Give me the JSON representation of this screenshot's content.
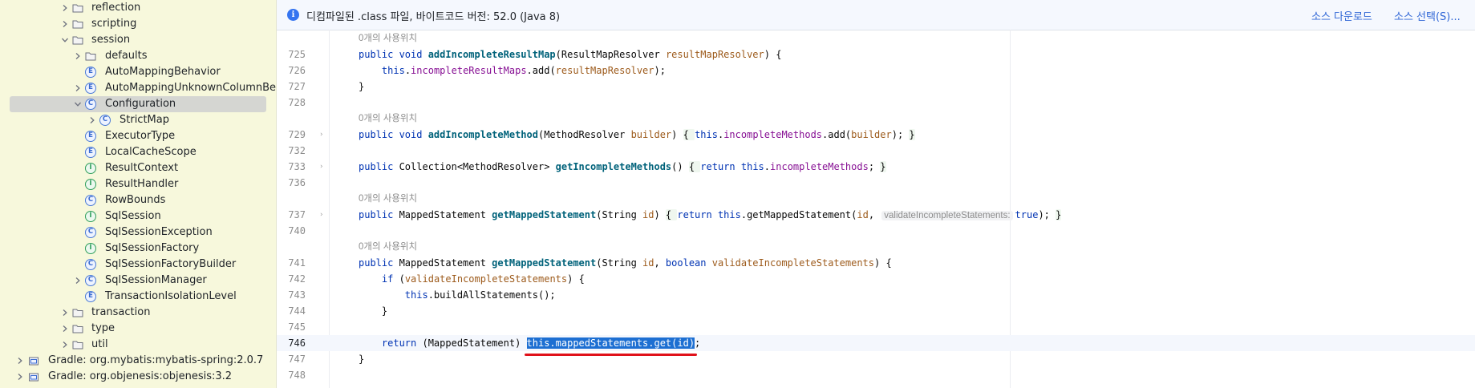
{
  "tree": [
    {
      "label": "reflection",
      "kind": "folder",
      "chevron": "right"
    },
    {
      "label": "scripting",
      "kind": "folder",
      "chevron": "right"
    },
    {
      "label": "session",
      "kind": "folder",
      "chevron": "down"
    },
    {
      "label": "defaults",
      "kind": "folder",
      "chevron": "right"
    },
    {
      "label": "AutoMappingBehavior",
      "kind": "enum"
    },
    {
      "label": "AutoMappingUnknownColumnBehavior",
      "kind": "enum",
      "chevron": "right"
    },
    {
      "label": "Configuration",
      "kind": "class",
      "chevron": "down",
      "selected": true
    },
    {
      "label": "StrictMap",
      "kind": "class",
      "chevron": "right"
    },
    {
      "label": "ExecutorType",
      "kind": "enum"
    },
    {
      "label": "LocalCacheScope",
      "kind": "enum"
    },
    {
      "label": "ResultContext",
      "kind": "interface"
    },
    {
      "label": "ResultHandler",
      "kind": "interface"
    },
    {
      "label": "RowBounds",
      "kind": "class"
    },
    {
      "label": "SqlSession",
      "kind": "interface"
    },
    {
      "label": "SqlSessionException",
      "kind": "class"
    },
    {
      "label": "SqlSessionFactory",
      "kind": "interface"
    },
    {
      "label": "SqlSessionFactoryBuilder",
      "kind": "class"
    },
    {
      "label": "SqlSessionManager",
      "kind": "class",
      "chevron": "right"
    },
    {
      "label": "TransactionIsolationLevel",
      "kind": "enum"
    },
    {
      "label": "transaction",
      "kind": "folder",
      "chevron": "right"
    },
    {
      "label": "type",
      "kind": "folder",
      "chevron": "right"
    },
    {
      "label": "util",
      "kind": "folder",
      "chevron": "right"
    },
    {
      "label": "Gradle: org.mybatis:mybatis-spring:2.0.7",
      "kind": "library",
      "chevron": "right"
    },
    {
      "label": "Gradle: org.objenesis:objenesis:3.2",
      "kind": "library",
      "chevron": "right"
    }
  ],
  "banner": {
    "message": "디컴파일된 .class 파일, 바이트코드 버전: 52.0 (Java 8)",
    "download_label": "소스 다운로드",
    "choose_label": "소스 선택(S)..."
  },
  "usages_hint": "0개의 사용위치",
  "param_hint": "validateIncompleteStatements:",
  "code": [
    {
      "type": "hint"
    },
    {
      "ln": "725",
      "tokens": [
        [
          "kw",
          "public "
        ],
        [
          "kw",
          "void "
        ],
        [
          "fn",
          "addIncompleteResultMap"
        ],
        [
          "tp",
          "(ResultMapResolver "
        ],
        [
          "prm",
          "resultMapResolver"
        ],
        [
          "tp",
          ") {"
        ]
      ]
    },
    {
      "ln": "726",
      "tokens": [
        [
          "tp",
          "    "
        ],
        [
          "kw",
          "this"
        ],
        [
          "tp",
          "."
        ],
        [
          "fld",
          "incompleteResultMaps"
        ],
        [
          "tp",
          ".add("
        ],
        [
          "prm",
          "resultMapResolver"
        ],
        [
          "tp",
          ");"
        ]
      ]
    },
    {
      "ln": "727",
      "tokens": [
        [
          "tp",
          "}"
        ]
      ]
    },
    {
      "ln": "728",
      "tokens": []
    },
    {
      "type": "hint"
    },
    {
      "ln": "729",
      "fold": true,
      "tokens": [
        [
          "kw",
          "public "
        ],
        [
          "kw",
          "void "
        ],
        [
          "fn",
          "addIncompleteMethod"
        ],
        [
          "tp",
          "(MethodResolver "
        ],
        [
          "prm",
          "builder"
        ],
        [
          "tp",
          ") "
        ],
        [
          "g",
          "{ "
        ],
        [
          "kw",
          "this"
        ],
        [
          "tp",
          "."
        ],
        [
          "fld",
          "incompleteMethods"
        ],
        [
          "tp",
          ".add("
        ],
        [
          "prm",
          "builder"
        ],
        [
          "tp",
          "); "
        ],
        [
          "g",
          "}"
        ]
      ]
    },
    {
      "ln": "732",
      "tokens": []
    },
    {
      "ln": "733",
      "fold": true,
      "tokens": [
        [
          "kw",
          "public "
        ],
        [
          "tp",
          "Collection<MethodResolver> "
        ],
        [
          "fn",
          "getIncompleteMethods"
        ],
        [
          "tp",
          "() "
        ],
        [
          "g",
          "{ "
        ],
        [
          "kw",
          "return "
        ],
        [
          "kw",
          "this"
        ],
        [
          "tp",
          "."
        ],
        [
          "fld",
          "incompleteMethods"
        ],
        [
          "tp",
          "; "
        ],
        [
          "g",
          "}"
        ]
      ]
    },
    {
      "ln": "736",
      "tokens": []
    },
    {
      "type": "hint"
    },
    {
      "ln": "737",
      "fold": true,
      "tokens": [
        [
          "kw",
          "public "
        ],
        [
          "tp",
          "MappedStatement "
        ],
        [
          "fn",
          "getMappedStatement"
        ],
        [
          "tp",
          "(String "
        ],
        [
          "prm",
          "id"
        ],
        [
          "tp",
          ") "
        ],
        [
          "g",
          "{ "
        ],
        [
          "kw",
          "return "
        ],
        [
          "kw",
          "this"
        ],
        [
          "tp",
          ".getMappedStatement("
        ],
        [
          "prm",
          "id"
        ],
        [
          "tp",
          ", "
        ],
        [
          "ph",
          "validateIncompleteStatements:"
        ],
        [
          "kw",
          "true"
        ],
        [
          "tp",
          "); "
        ],
        [
          "g",
          "}"
        ]
      ]
    },
    {
      "ln": "740",
      "tokens": []
    },
    {
      "type": "hint"
    },
    {
      "ln": "741",
      "tokens": [
        [
          "kw",
          "public "
        ],
        [
          "tp",
          "MappedStatement "
        ],
        [
          "fn",
          "getMappedStatement"
        ],
        [
          "tp",
          "(String "
        ],
        [
          "prm",
          "id"
        ],
        [
          "tp",
          ", "
        ],
        [
          "kw",
          "boolean "
        ],
        [
          "prm",
          "validateIncompleteStatements"
        ],
        [
          "tp",
          ") {"
        ]
      ]
    },
    {
      "ln": "742",
      "tokens": [
        [
          "tp",
          "    "
        ],
        [
          "kw",
          "if "
        ],
        [
          "tp",
          "("
        ],
        [
          "prm",
          "validateIncompleteStatements"
        ],
        [
          "tp",
          ") {"
        ]
      ]
    },
    {
      "ln": "743",
      "tokens": [
        [
          "tp",
          "        "
        ],
        [
          "kw",
          "this"
        ],
        [
          "tp",
          ".buildAllStatements();"
        ]
      ]
    },
    {
      "ln": "744",
      "tokens": [
        [
          "tp",
          "    }"
        ]
      ]
    },
    {
      "ln": "745",
      "tokens": []
    },
    {
      "ln": "746",
      "current": true,
      "tokens": [
        [
          "tp",
          "    "
        ],
        [
          "kw",
          "return "
        ],
        [
          "tp",
          "(MappedStatement) "
        ],
        [
          "sel",
          "this.mappedStatements.get(id)"
        ],
        [
          "tp",
          ";"
        ]
      ]
    },
    {
      "ln": "747",
      "tokens": [
        [
          "tp",
          "}"
        ]
      ]
    },
    {
      "ln": "748",
      "tokens": []
    }
  ],
  "colors": {
    "keyword": "#0033b3",
    "method": "#00627a",
    "field": "#871094",
    "param": "#9d5b1c",
    "selection": "#1d6fd2",
    "annotation_red": "#e0111a",
    "tree_bg": "#f7f8dc"
  }
}
